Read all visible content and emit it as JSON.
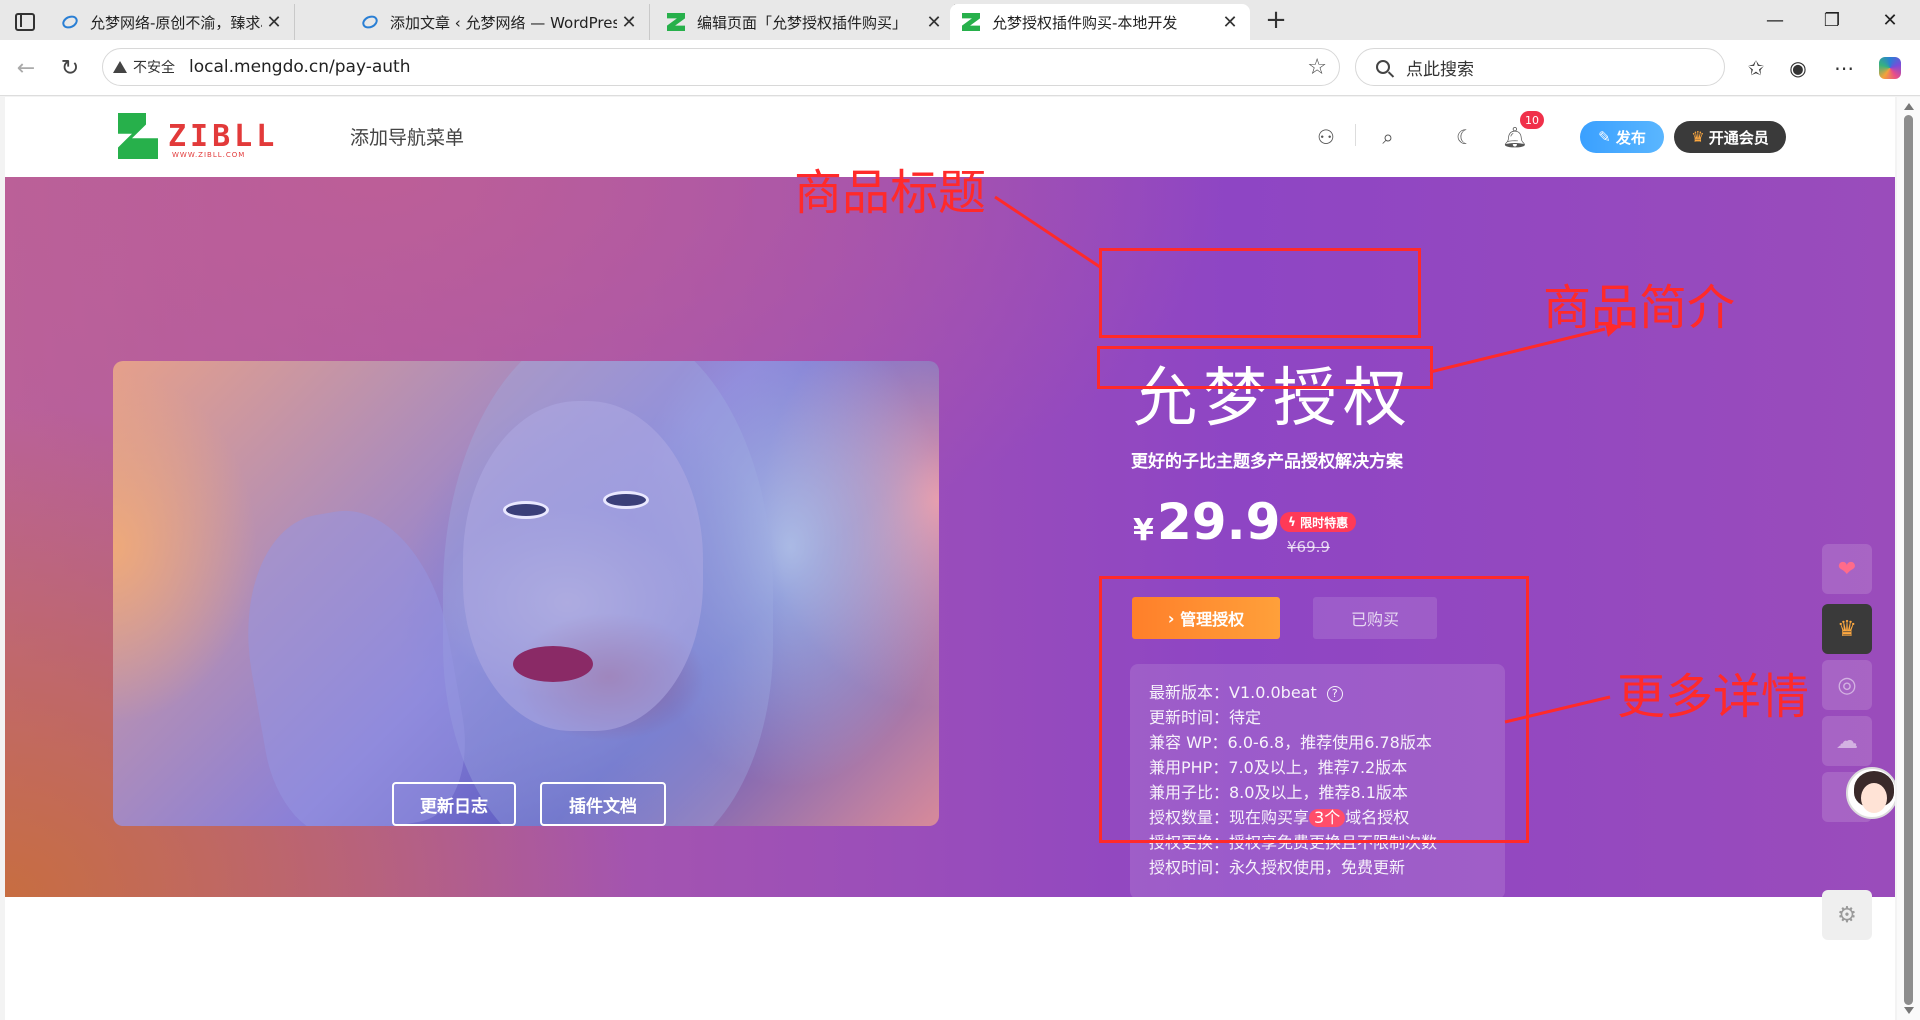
{
  "browser": {
    "tabs": [
      {
        "title": "允梦网络-原创不渝，臻求尽美!",
        "favicon": "ie-icon"
      },
      {
        "title": "添加文章 ‹ 允梦网络 — WordPres",
        "favicon": "ie-icon"
      },
      {
        "title": "编辑页面「允梦授权插件购买」",
        "favicon": "zibll-icon"
      },
      {
        "title": "允梦授权插件购买-本地开发",
        "favicon": "zibll-icon"
      }
    ],
    "security_label": "不安全",
    "url": "local.mengdo.cn/pay-auth",
    "search_placeholder": "点此搜索"
  },
  "site": {
    "logo_text": "ZIBLL",
    "logo_sub": "WWW.ZIBLL.COM",
    "nav_item": "添加导航菜单",
    "notification_count": "10",
    "publish_label": "发布",
    "vip_label": "开通会员"
  },
  "product": {
    "title": "允梦授权",
    "description": "更好的子比主题多产品授权解决方案",
    "currency": "¥",
    "price": "29.9",
    "promo_badge": "限时特惠",
    "original_price": "¥69.9",
    "manage_button": "管理授权",
    "bought_button": "已购买",
    "changelog_button": "更新日志",
    "docs_button": "插件文档",
    "details": {
      "version": "最新版本：V1.0.0beat",
      "update_time": "更新时间：待定",
      "wp_compat": "兼容 WP：6.0-6.8，推荐使用6.78版本",
      "php_compat": "兼用PHP：7.0及以上，推荐7.2版本",
      "zibll_compat": "兼用子比：8.0及以上，推荐8.1版本",
      "license_prefix": "授权数量：现在购买享",
      "license_highlight": "3个",
      "license_suffix": "域名授权",
      "license_change": "授权更换：授权享免费更换且不限制次数",
      "license_time": "授权时间：永久授权使用，免费更新"
    }
  },
  "annotations": {
    "title_label": "商品标题",
    "desc_label": "商品简介",
    "details_label": "更多详情",
    "color": "#ff2a2a"
  },
  "colors": {
    "accent_orange": "#ff8a2e",
    "publish_blue": "#3aa0ff",
    "badge_red": "#f0304a"
  }
}
